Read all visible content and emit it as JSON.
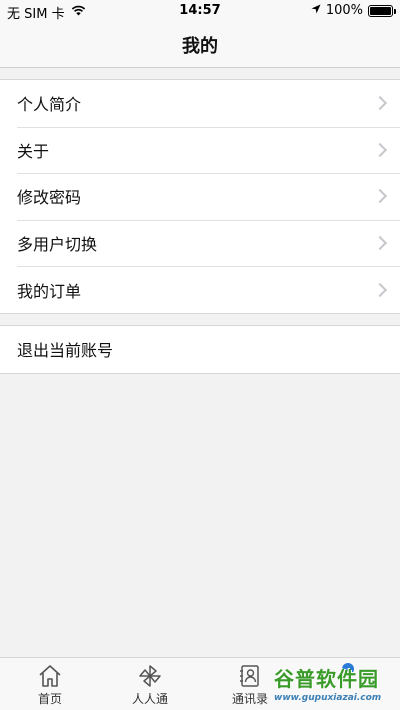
{
  "status": {
    "carrier": "无 SIM 卡",
    "time": "14:57",
    "battery": "100%",
    "battery_level": 1.0
  },
  "nav": {
    "title": "我的"
  },
  "menu": [
    {
      "label": "个人简介"
    },
    {
      "label": "关于"
    },
    {
      "label": "修改密码"
    },
    {
      "label": "多用户切换"
    },
    {
      "label": "我的订单"
    }
  ],
  "logout": {
    "label": "退出当前账号"
  },
  "tabs": [
    {
      "label": "首页",
      "icon": "home-icon"
    },
    {
      "label": "人人通",
      "icon": "pinwheel-icon"
    },
    {
      "label": "通讯录",
      "icon": "contacts-icon"
    },
    {
      "label": "",
      "icon": "profile-icon"
    }
  ],
  "watermark": {
    "cn": "谷普软件园",
    "en": "www.gupuxiazai.com"
  },
  "colors": {
    "accent": "#2a7bd8",
    "background": "#f2f2f2",
    "chevron": "#c7c7cc"
  }
}
